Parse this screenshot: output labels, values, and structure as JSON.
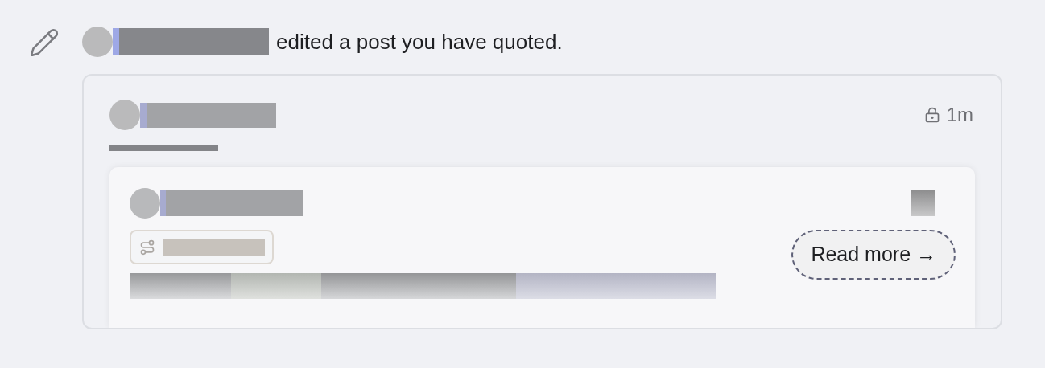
{
  "notification": {
    "message": "edited a post you have quoted."
  },
  "post": {
    "time": "1m",
    "quoted_post": {
      "read_more": "Read more →"
    }
  }
}
